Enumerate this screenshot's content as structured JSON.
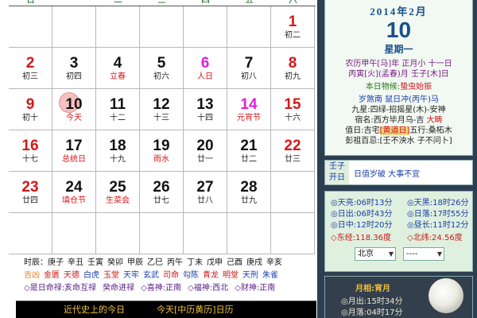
{
  "weekday_headers": [
    "日",
    "一",
    "二",
    "三",
    "四",
    "五",
    "六"
  ],
  "calendar": {
    "weeks": [
      [
        {
          "d": "",
          "s": ""
        },
        {
          "d": "",
          "s": ""
        },
        {
          "d": "",
          "s": ""
        },
        {
          "d": "",
          "s": ""
        },
        {
          "d": "",
          "s": ""
        },
        {
          "d": "",
          "s": ""
        },
        {
          "d": "1",
          "s": "初二",
          "cls": "weekend"
        }
      ],
      [
        {
          "d": "2",
          "s": "初三",
          "cls": "weekend"
        },
        {
          "d": "3",
          "s": "初四"
        },
        {
          "d": "4",
          "s": "立春",
          "cls": "term"
        },
        {
          "d": "5",
          "s": "初六"
        },
        {
          "d": "6",
          "s": "人日",
          "cls": "festival-magenta"
        },
        {
          "d": "7",
          "s": "初八"
        },
        {
          "d": "8",
          "s": "初九",
          "cls": "weekend"
        }
      ],
      [
        {
          "d": "9",
          "s": "初十",
          "cls": "weekend"
        },
        {
          "d": "10",
          "s": "今天",
          "cls": "today"
        },
        {
          "d": "11",
          "s": "十二"
        },
        {
          "d": "12",
          "s": "十三"
        },
        {
          "d": "13",
          "s": "十四"
        },
        {
          "d": "14",
          "s": "元宵节",
          "cls": "festival-magenta"
        },
        {
          "d": "15",
          "s": "十六",
          "cls": "weekend"
        }
      ],
      [
        {
          "d": "16",
          "s": "十七",
          "cls": "weekend"
        },
        {
          "d": "17",
          "s": "总统日",
          "cls": "festival"
        },
        {
          "d": "18",
          "s": "十九"
        },
        {
          "d": "19",
          "s": "雨水",
          "cls": "term"
        },
        {
          "d": "20",
          "s": "廿一"
        },
        {
          "d": "21",
          "s": "廿二"
        },
        {
          "d": "22",
          "s": "廿三",
          "cls": "weekend"
        }
      ],
      [
        {
          "d": "23",
          "s": "廿四",
          "cls": "weekend"
        },
        {
          "d": "24",
          "s": "填仓节",
          "cls": "festival"
        },
        {
          "d": "25",
          "s": "生菜会",
          "cls": "festival"
        },
        {
          "d": "26",
          "s": "廿七"
        },
        {
          "d": "27",
          "s": "廿八"
        },
        {
          "d": "28",
          "s": "廿九"
        },
        {
          "d": "",
          "s": ""
        }
      ],
      [
        {
          "d": "",
          "s": ""
        },
        {
          "d": "",
          "s": ""
        },
        {
          "d": "",
          "s": ""
        },
        {
          "d": "",
          "s": ""
        },
        {
          "d": "",
          "s": ""
        },
        {
          "d": "",
          "s": ""
        },
        {
          "d": "",
          "s": ""
        }
      ]
    ]
  },
  "info": {
    "hours_label": "时辰：",
    "hours": [
      "庚子",
      "辛丑",
      "壬寅",
      "癸卯",
      "甲辰",
      "乙巳",
      "丙午",
      "丁未",
      "戊申",
      "己酉",
      "庚戌",
      "辛亥"
    ],
    "gods": [
      {
        "t": "吉凶",
        "k": "orange"
      },
      {
        "t": "金匮",
        "k": ""
      },
      {
        "t": "天德",
        "k": ""
      },
      {
        "t": "白虎",
        "k": "good"
      },
      {
        "t": "玉堂",
        "k": ""
      },
      {
        "t": "天牢",
        "k": "good"
      },
      {
        "t": "玄武",
        "k": "good"
      },
      {
        "t": "司命",
        "k": ""
      },
      {
        "t": "勾陈",
        "k": "good"
      },
      {
        "t": "青龙",
        "k": ""
      },
      {
        "t": "明堂",
        "k": ""
      },
      {
        "t": "天刑",
        "k": "good"
      },
      {
        "t": "朱雀",
        "k": "good"
      }
    ],
    "clash": [
      "◇是日命禄:亥命互禄",
      "癸命进禄",
      "◇喜神:正南",
      "◇福神:西北",
      "◇财神:正南"
    ],
    "bottom_items": [
      "近代史上的今日",
      "今天[中历黄历]日历"
    ]
  },
  "almanac": {
    "date_line": "2014年2月",
    "day": "10",
    "weekday": "星期一",
    "lunar_line": "农历甲午[马]年 正月小 十一日",
    "ganzhi_line": "丙寅[火](孟春)月  壬子[木]日",
    "phenology_prefix": "本日物候:",
    "phenology_value": "蛰虫始振",
    "conflict": "岁煞南  鼠日冲(丙午)马",
    "nine_star": "九星:四绿-招摇星(木)-安神",
    "mansion_prefix": "宿名:西方毕月乌-吉",
    "mansion_value": "大畴",
    "duty_prefix": "值日:吉宅",
    "duty_tag": "[黄道日]",
    "duty_suffix": "五行:桑柘木",
    "pengzu": "彭祖百忌:[壬不泱水  子不问卜]",
    "yiji_label_1": "壬子",
    "yiji_label_2": "开日",
    "yiji_text": "日值岁破  大事不宜",
    "sun": [
      {
        "a": "◎天亮:06时13分",
        "b": "◎天黑:18时26分"
      },
      {
        "a": "◎日出:06时43分",
        "b": "◎日落:17时55分"
      },
      {
        "a": "◎日中:12时20分",
        "b": "◎昼长:11时12分"
      }
    ],
    "geo": {
      "a": "◇东经:118.36度",
      "b": "◇北纬:24.56度"
    },
    "city": "北京",
    "district": "----",
    "moon_title": "月相:宵月",
    "moonrise": "◎月出:15时34分",
    "moonset": "◎月落:04时17分"
  }
}
